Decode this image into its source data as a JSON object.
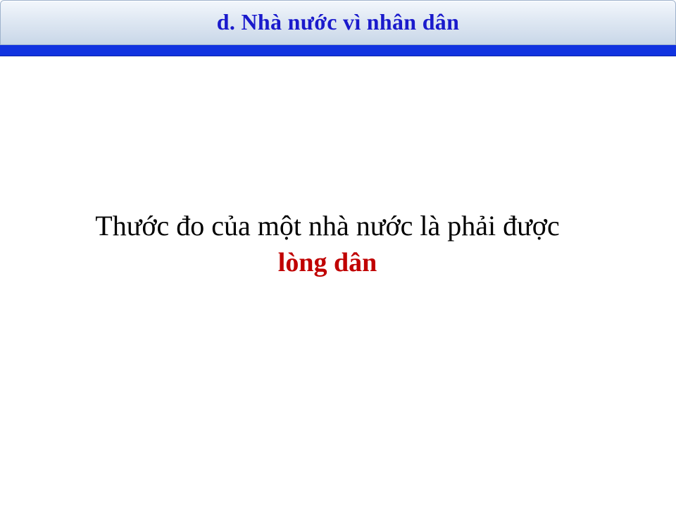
{
  "header": {
    "title": "d. Nhà nước vì nhân dân"
  },
  "body": {
    "statement": "Thước đo của một nhà nước là phải được",
    "highlight": "lòng dân"
  },
  "colors": {
    "title_text": "#1a1acc",
    "accent_bar": "#1133e0",
    "highlight_text": "#c00000",
    "body_text": "#000000"
  }
}
